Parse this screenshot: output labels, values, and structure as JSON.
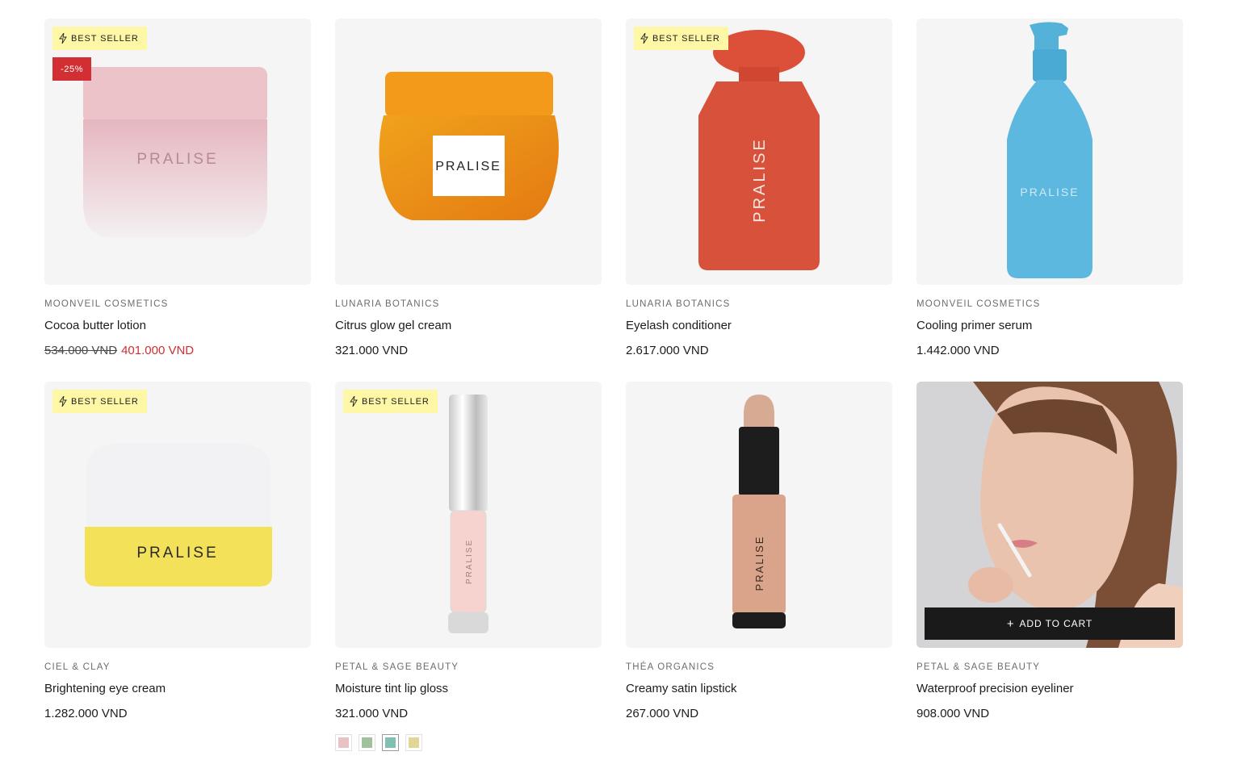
{
  "badges": {
    "best_seller": "BEST SELLER",
    "sale": "-25%"
  },
  "actions": {
    "add_to_cart": "ADD TO CART",
    "plus": "+"
  },
  "brand_mark": "PRALISE",
  "products": [
    {
      "vendor": "MOONVEIL COSMETICS",
      "title": "Cocoa butter lotion",
      "price": "401.000 VND",
      "compare_price": "534.000 VND",
      "best_seller": true,
      "on_sale": true
    },
    {
      "vendor": "LUNARIA BOTANICS",
      "title": "Citrus glow gel cream",
      "price": "321.000 VND",
      "best_seller": false
    },
    {
      "vendor": "LUNARIA BOTANICS",
      "title": "Eyelash conditioner",
      "price": "2.617.000 VND",
      "best_seller": true
    },
    {
      "vendor": "MOONVEIL COSMETICS",
      "title": "Cooling primer serum",
      "price": "1.442.000 VND",
      "best_seller": false
    },
    {
      "vendor": "CIEL & CLAY",
      "title": "Brightening eye cream",
      "price": "1.282.000 VND",
      "best_seller": true
    },
    {
      "vendor": "PETAL & SAGE BEAUTY",
      "title": "Moisture tint lip gloss",
      "price": "321.000 VND",
      "best_seller": true,
      "swatches": [
        "#e8c2c4",
        "#9fc29c",
        "#7fc0b3",
        "#e2d696"
      ]
    },
    {
      "vendor": "THÉA ORGANICS",
      "title": "Creamy satin lipstick",
      "price": "267.000 VND",
      "best_seller": false
    },
    {
      "vendor": "PETAL & SAGE BEAUTY",
      "title": "Waterproof precision eyeliner",
      "price": "908.000 VND",
      "best_seller": false
    }
  ],
  "colors": {
    "sale": "#d12f33",
    "best_seller_bg": "#fdf7a6",
    "card_bg": "#f5f5f5",
    "cart_button": "#1a1a1a"
  }
}
